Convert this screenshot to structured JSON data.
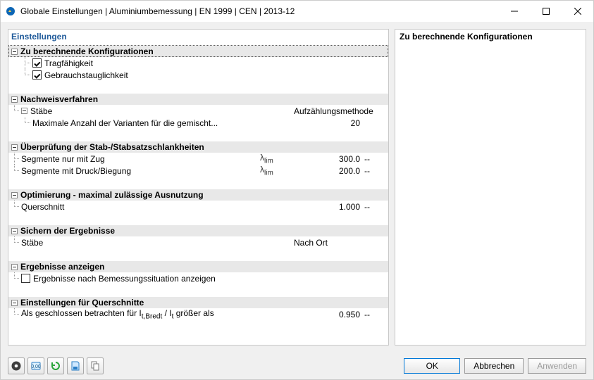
{
  "window": {
    "title": "Globale Einstellungen | Aluminiumbemessung | EN 1999 | CEN | 2013-12"
  },
  "leftPanel": {
    "title": "Einstellungen"
  },
  "rightPanel": {
    "title": "Zu berechnende Konfigurationen"
  },
  "groups": {
    "g0": {
      "label": "Zu berechnende Konfigurationen"
    },
    "g1": {
      "label": "Nachweisverfahren"
    },
    "g2": {
      "label": "Überprüfung der Stab-/Stabsatzschlankheiten"
    },
    "g3": {
      "label": "Optimierung - maximal zulässige Ausnutzung"
    },
    "g4": {
      "label": "Sichern der Ergebnisse"
    },
    "g5": {
      "label": "Ergebnisse anzeigen"
    },
    "g6": {
      "label": "Einstellungen für Querschnitte"
    }
  },
  "items": {
    "i00": {
      "label": "Tragfähigkeit"
    },
    "i01": {
      "label": "Gebrauchstauglichkeit"
    },
    "i10": {
      "label": "Stäbe",
      "value": "Aufzählungsmethode"
    },
    "i10a": {
      "label": "Maximale Anzahl der Varianten für die gemischt...",
      "value": "20"
    },
    "i20": {
      "label": "Segmente nur mit Zug",
      "value": "300.0",
      "unit": "--"
    },
    "i21": {
      "label": "Segmente mit Druck/Biegung",
      "value": "200.0",
      "unit": "--"
    },
    "i30": {
      "label": "Querschnitt",
      "value": "1.000",
      "unit": "--"
    },
    "i40": {
      "label": "Stäbe",
      "value": "Nach Ort"
    },
    "i50": {
      "label": "Ergebnisse nach Bemessungssituation anzeigen"
    },
    "i60": {
      "label_before": "Als geschlossen betrachten für I",
      "label_mid": " / I",
      "label_after": " größer als",
      "sub1": "t,Bredt",
      "sub2": "t",
      "value": "0.950",
      "unit": "--"
    }
  },
  "symbols": {
    "lambda_lim": "λlim"
  },
  "buttons": {
    "ok": "OK",
    "cancel": "Abbrechen",
    "apply": "Anwenden"
  }
}
